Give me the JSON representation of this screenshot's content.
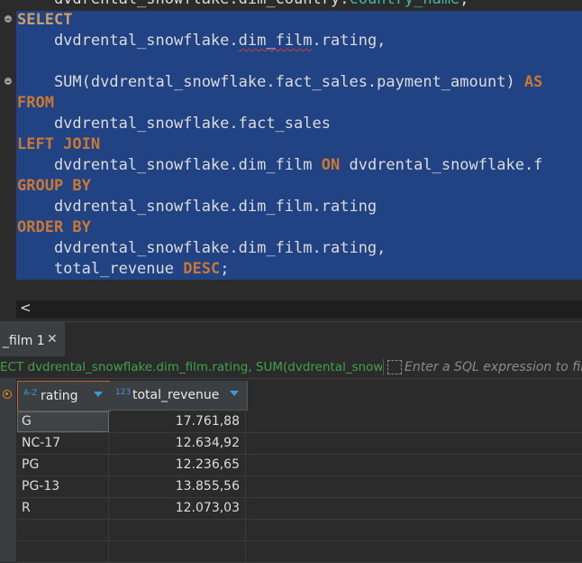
{
  "editor": {
    "lines": [
      {
        "segments": [
          {
            "t": "    dvdrental_snowflake.dim_country.",
            "c": "ident"
          },
          {
            "t": "country_name",
            "c": "teal"
          },
          {
            "t": ";",
            "c": "ident"
          }
        ]
      },
      {
        "segments": [
          {
            "t": "SELECT",
            "c": "kwsel"
          }
        ]
      },
      {
        "segments": [
          {
            "t": "    dvdrental_snowflake.",
            "c": "ident"
          },
          {
            "t": "dim_film",
            "c": "ident squig"
          },
          {
            "t": ".rating,",
            "c": "ident"
          }
        ]
      },
      {
        "segments": [
          {
            "t": "",
            "c": "ident"
          }
        ]
      },
      {
        "segments": [
          {
            "t": "    SUM(dvdrental_snowflake.fact_sales.payment_amount) ",
            "c": "ident"
          },
          {
            "t": "AS",
            "c": "kw"
          }
        ]
      },
      {
        "segments": [
          {
            "t": "FROM",
            "c": "kw"
          }
        ]
      },
      {
        "segments": [
          {
            "t": "    dvdrental_snowflake.fact_sales",
            "c": "ident"
          }
        ]
      },
      {
        "segments": [
          {
            "t": "LEFT JOIN",
            "c": "kw"
          }
        ]
      },
      {
        "segments": [
          {
            "t": "    dvdrental_snowflake.dim_film ",
            "c": "ident"
          },
          {
            "t": "ON",
            "c": "kw"
          },
          {
            "t": " dvdrental_snowflake.f",
            "c": "ident"
          }
        ]
      },
      {
        "segments": [
          {
            "t": "GROUP BY",
            "c": "kw"
          }
        ]
      },
      {
        "segments": [
          {
            "t": "    dvdrental_snowflake.dim_film.rating",
            "c": "ident"
          }
        ]
      },
      {
        "segments": [
          {
            "t": "ORDER BY",
            "c": "kw"
          }
        ]
      },
      {
        "segments": [
          {
            "t": "    dvdrental_snowflake.dim_film.rating,",
            "c": "ident"
          }
        ]
      },
      {
        "segments": [
          {
            "t": "    total_revenue ",
            "c": "ident"
          },
          {
            "t": "DESC",
            "c": "kw"
          },
          {
            "t": ";",
            "c": "ident"
          }
        ]
      }
    ],
    "scroll_left_glyph": "<"
  },
  "results": {
    "tab_label": "_film 1",
    "tab_close_glyph": "✕",
    "filter_sql": "ECT dvdrental_snowflake.dim_film.rating, SUM(dvdrental_snowfl",
    "filter_placeholder": "Enter a SQL expression to filter",
    "columns": [
      {
        "type_badge": "A-Z",
        "name": "rating"
      },
      {
        "type_badge": "123",
        "name": "total_revenue"
      }
    ],
    "rows": [
      {
        "rating": "G",
        "total_revenue": "17.761,88"
      },
      {
        "rating": "NC-17",
        "total_revenue": "12.634,92"
      },
      {
        "rating": "PG",
        "total_revenue": "12.236,65"
      },
      {
        "rating": "PG-13",
        "total_revenue": "13.855,56"
      },
      {
        "rating": "R",
        "total_revenue": "12.073,03"
      }
    ],
    "empty_rows": 2
  }
}
